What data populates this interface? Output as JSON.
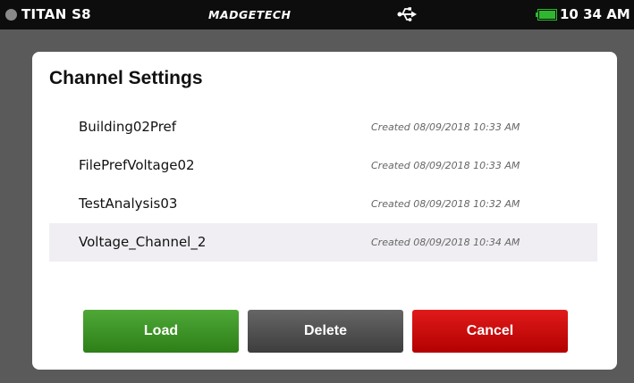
{
  "status_bar": {
    "device_name": "TITAN S8",
    "brand": "MADGETECH",
    "usb_icon": "usb-icon",
    "battery_icon": "battery-icon",
    "battery_color": "#2fb82f",
    "time": "10 34 AM"
  },
  "dialog": {
    "title": "Channel Settings",
    "channels": [
      {
        "name": "Building02Pref",
        "created": "Created 08/09/2018 10:33 AM",
        "selected": false
      },
      {
        "name": "FilePrefVoltage02",
        "created": "Created 08/09/2018 10:33 AM",
        "selected": false
      },
      {
        "name": "TestAnalysis03",
        "created": "Created 08/09/2018 10:32 AM",
        "selected": false
      },
      {
        "name": "Voltage_Channel_2",
        "created": "Created 08/09/2018 10:34 AM",
        "selected": true
      }
    ],
    "buttons": {
      "load": "Load",
      "delete": "Delete",
      "cancel": "Cancel"
    },
    "colors": {
      "load": "#3a9a24",
      "delete": "#505050",
      "cancel": "#cc0d0d",
      "selected_row": "#f0eef3"
    }
  }
}
